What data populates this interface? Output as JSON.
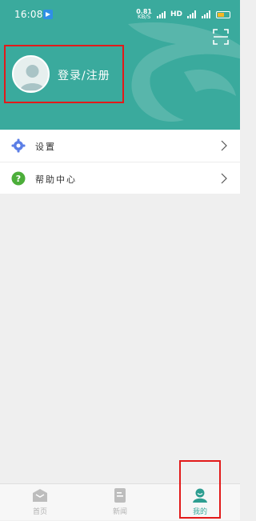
{
  "status_bar": {
    "time": "16:08",
    "net_speed_value": "0.81",
    "net_speed_unit": "KB/S",
    "hd_label": "HD",
    "battery_level": "60"
  },
  "header": {
    "login_label": "登录/注册",
    "accent_color": "#3aaa9d"
  },
  "menu": {
    "items": [
      {
        "label": "设置",
        "icon": "gear-icon"
      },
      {
        "label": "帮助中心",
        "icon": "help-icon"
      }
    ]
  },
  "tabbar": {
    "tabs": [
      {
        "label": "首页",
        "icon": "home-icon",
        "active": false
      },
      {
        "label": "新闻",
        "icon": "news-icon",
        "active": false
      },
      {
        "label": "我的",
        "icon": "profile-icon",
        "active": true
      }
    ]
  },
  "highlight_color": "#e21a1a"
}
